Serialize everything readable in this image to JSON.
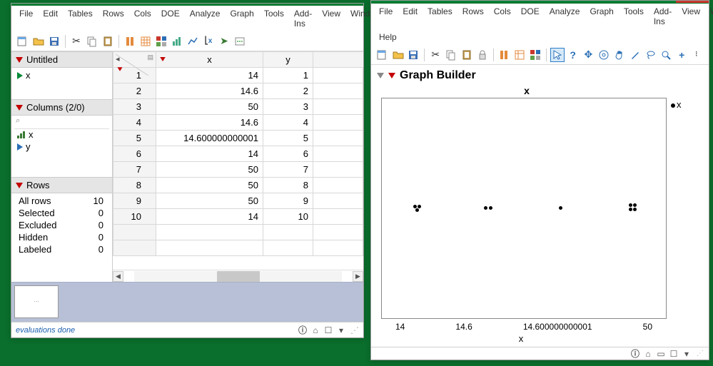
{
  "menus": [
    "File",
    "Edit",
    "Tables",
    "Rows",
    "Cols",
    "DOE",
    "Analyze",
    "Graph",
    "Tools",
    "Add-Ins",
    "View",
    "Window",
    "Help"
  ],
  "menus_right_row2": [
    "Help"
  ],
  "left": {
    "title": "Untitled",
    "sub_item": "x",
    "columns_hdr": "Columns (2/0)",
    "col1": "x",
    "col2": "y",
    "rows_hdr": "Rows",
    "rows": [
      {
        "label": "All rows",
        "n": "10"
      },
      {
        "label": "Selected",
        "n": "0"
      },
      {
        "label": "Excluded",
        "n": "0"
      },
      {
        "label": "Hidden",
        "n": "0"
      },
      {
        "label": "Labeled",
        "n": "0"
      }
    ],
    "grid": {
      "headers": [
        "x",
        "y"
      ],
      "rows": [
        {
          "r": "1",
          "x": "14",
          "y": "1"
        },
        {
          "r": "2",
          "x": "14.6",
          "y": "2"
        },
        {
          "r": "3",
          "x": "50",
          "y": "3"
        },
        {
          "r": "4",
          "x": "14.6",
          "y": "4"
        },
        {
          "r": "5",
          "x": "14.600000000001",
          "y": "5"
        },
        {
          "r": "6",
          "x": "14",
          "y": "6"
        },
        {
          "r": "7",
          "x": "50",
          "y": "7"
        },
        {
          "r": "8",
          "x": "50",
          "y": "8"
        },
        {
          "r": "9",
          "x": "50",
          "y": "9"
        },
        {
          "r": "10",
          "x": "14",
          "y": "10"
        }
      ]
    },
    "status": "evaluations done"
  },
  "right": {
    "title": "Graph Builder",
    "xtop": "x",
    "xbottom": "x",
    "legend": "x",
    "ticks": [
      "14",
      "14.6",
      "14.600000000001",
      "50"
    ]
  },
  "chart_data": {
    "type": "scatter",
    "title": "Graph Builder",
    "xlabel": "x",
    "ylabel": "",
    "x_ticks": [
      "14",
      "14.6",
      "14.600000000001",
      "50"
    ],
    "series": [
      {
        "name": "x",
        "x": [
          14,
          14.6,
          50,
          14.6,
          14.600000000001,
          14,
          50,
          50,
          50,
          14
        ],
        "y": [
          1,
          2,
          3,
          4,
          5,
          6,
          7,
          8,
          9,
          10
        ]
      }
    ],
    "note": "Plot shows x values as categorical positions with jittered points on a single horizontal band."
  }
}
